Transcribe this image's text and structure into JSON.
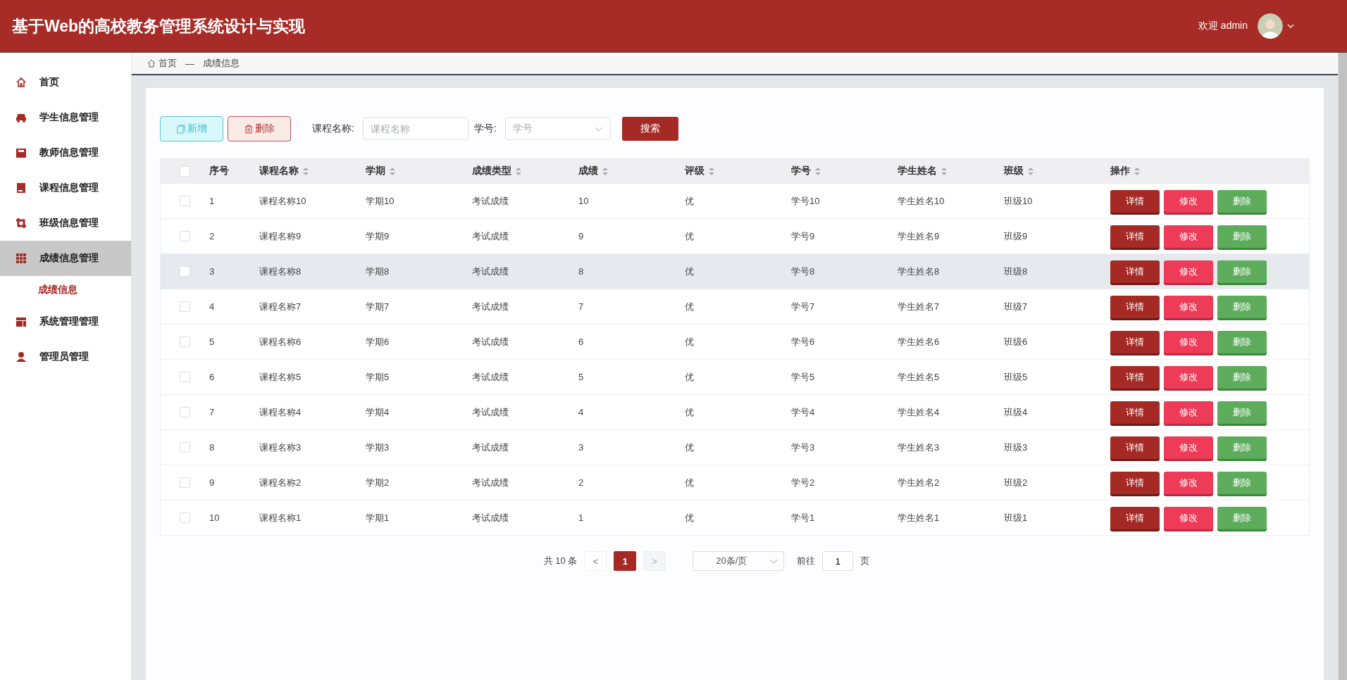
{
  "header": {
    "title": "基于Web的高校教务管理系统设计与实现",
    "welcome": "欢迎 admin"
  },
  "sidebar": {
    "items": [
      {
        "label": "首页",
        "selected": false
      },
      {
        "label": "学生信息管理",
        "selected": false
      },
      {
        "label": "教师信息管理",
        "selected": false
      },
      {
        "label": "课程信息管理",
        "selected": false
      },
      {
        "label": "班级信息管理",
        "selected": false
      },
      {
        "label": "成绩信息管理",
        "selected": true,
        "children": [
          {
            "label": "成绩信息",
            "selected": true
          }
        ]
      },
      {
        "label": "系统管理管理",
        "selected": false
      },
      {
        "label": "管理员管理",
        "selected": false
      }
    ]
  },
  "breadcrumb": {
    "home": "首页",
    "separator": "—",
    "current": "成绩信息"
  },
  "toolbar": {
    "add_button": "新增",
    "delete_button": "删除",
    "course_label": "课程名称:",
    "course_placeholder": "课程名称",
    "student_label": "学号:",
    "student_placeholder": "学号",
    "search_button": "搜索"
  },
  "table": {
    "select_all_checked": false,
    "columns": [
      {
        "label": "序号",
        "sortable": false
      },
      {
        "label": "课程名称",
        "sortable": true
      },
      {
        "label": "学期",
        "sortable": true
      },
      {
        "label": "成绩类型",
        "sortable": true
      },
      {
        "label": "成绩",
        "sortable": true
      },
      {
        "label": "评级",
        "sortable": true
      },
      {
        "label": "学号",
        "sortable": true
      },
      {
        "label": "学生姓名",
        "sortable": true
      },
      {
        "label": "班级",
        "sortable": true
      },
      {
        "label": "操作",
        "sortable": true
      }
    ],
    "rows": [
      {
        "checked": false,
        "hovered": false,
        "cells": [
          "1",
          "课程名称10",
          "学期10",
          "考试成绩",
          "10",
          "优",
          "学号10",
          "学生姓名10",
          "班级10"
        ],
        "actions": [
          "详情",
          "修改",
          "删除"
        ]
      },
      {
        "checked": false,
        "hovered": false,
        "cells": [
          "2",
          "课程名称9",
          "学期9",
          "考试成绩",
          "9",
          "优",
          "学号9",
          "学生姓名9",
          "班级9"
        ],
        "actions": [
          "详情",
          "修改",
          "删除"
        ]
      },
      {
        "checked": false,
        "hovered": true,
        "cells": [
          "3",
          "课程名称8",
          "学期8",
          "考试成绩",
          "8",
          "优",
          "学号8",
          "学生姓名8",
          "班级8"
        ],
        "actions": [
          "详情",
          "修改",
          "删除"
        ]
      },
      {
        "checked": false,
        "hovered": false,
        "cells": [
          "4",
          "课程名称7",
          "学期7",
          "考试成绩",
          "7",
          "优",
          "学号7",
          "学生姓名7",
          "班级7"
        ],
        "actions": [
          "详情",
          "修改",
          "删除"
        ]
      },
      {
        "checked": false,
        "hovered": false,
        "cells": [
          "5",
          "课程名称6",
          "学期6",
          "考试成绩",
          "6",
          "优",
          "学号6",
          "学生姓名6",
          "班级6"
        ],
        "actions": [
          "详情",
          "修改",
          "删除"
        ]
      },
      {
        "checked": false,
        "hovered": false,
        "cells": [
          "6",
          "课程名称5",
          "学期5",
          "考试成绩",
          "5",
          "优",
          "学号5",
          "学生姓名5",
          "班级5"
        ],
        "actions": [
          "详情",
          "修改",
          "删除"
        ]
      },
      {
        "checked": false,
        "hovered": false,
        "cells": [
          "7",
          "课程名称4",
          "学期4",
          "考试成绩",
          "4",
          "优",
          "学号4",
          "学生姓名4",
          "班级4"
        ],
        "actions": [
          "详情",
          "修改",
          "删除"
        ]
      },
      {
        "checked": false,
        "hovered": false,
        "cells": [
          "8",
          "课程名称3",
          "学期3",
          "考试成绩",
          "3",
          "优",
          "学号3",
          "学生姓名3",
          "班级3"
        ],
        "actions": [
          "详情",
          "修改",
          "删除"
        ]
      },
      {
        "checked": false,
        "hovered": false,
        "cells": [
          "9",
          "课程名称2",
          "学期2",
          "考试成绩",
          "2",
          "优",
          "学号2",
          "学生姓名2",
          "班级2"
        ],
        "actions": [
          "详情",
          "修改",
          "删除"
        ]
      },
      {
        "checked": false,
        "hovered": false,
        "cells": [
          "10",
          "课程名称1",
          "学期1",
          "考试成绩",
          "1",
          "优",
          "学号1",
          "学生姓名1",
          "班级1"
        ],
        "actions": [
          "详情",
          "修改",
          "删除"
        ]
      }
    ]
  },
  "pagination": {
    "total": "共 10 条",
    "prev": "<",
    "pages": [
      {
        "label": "1",
        "selected": true
      }
    ],
    "next": ">",
    "page_size": "20条/页",
    "goto_label": "前往",
    "goto_value": "1",
    "goto_suffix": "页"
  }
}
